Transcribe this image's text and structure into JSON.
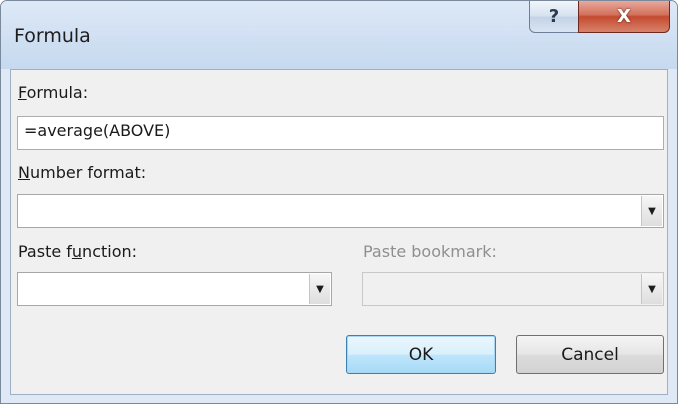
{
  "window": {
    "title": "Formula",
    "help_glyph": "?",
    "close_glyph": "X"
  },
  "formula": {
    "label_key": "F",
    "label_rest": "ormula:",
    "value": "=average(ABOVE)"
  },
  "number_format": {
    "label_key": "N",
    "label_rest": "umber format:",
    "value": ""
  },
  "paste_function": {
    "label_pre": "Paste f",
    "label_key": "u",
    "label_rest": "nction:",
    "value": ""
  },
  "paste_bookmark": {
    "label": "Paste bookmark:",
    "value": "",
    "enabled": false
  },
  "buttons": {
    "ok_label": "OK",
    "cancel_label": "Cancel"
  },
  "icons": {
    "dropdown": "chevron-down-icon",
    "help": "help-icon",
    "close": "close-icon"
  }
}
